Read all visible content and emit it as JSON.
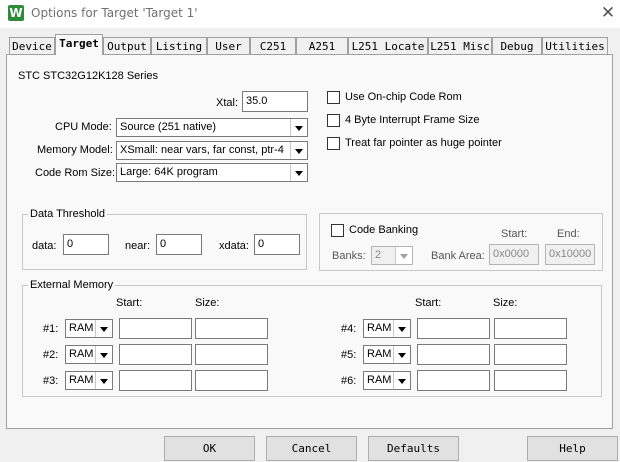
{
  "window": {
    "title": "Options for Target 'Target 1'",
    "app_icon_letter": "W"
  },
  "tabs": [
    "Device",
    "Target",
    "Output",
    "Listing",
    "User",
    "C251",
    "A251",
    "L251 Locate",
    "L251 Misc",
    "Debug",
    "Utilities"
  ],
  "active_tab": "Target",
  "target": {
    "series": "STC STC32G12K128 Series",
    "xtal_label": "Xtal:",
    "xtal_value": "35.0",
    "cpu_mode_label": "CPU Mode:",
    "cpu_mode_value": "Source (251 native)",
    "memory_model_label": "Memory Model:",
    "memory_model_value": "XSmall: near vars, far const, ptr-4",
    "code_rom_label": "Code Rom Size:",
    "code_rom_value": "Large: 64K program",
    "use_onchip_rom": "Use On-chip Code Rom",
    "four_byte_irq": "4 Byte Interrupt Frame Size",
    "far_pointer": "Treat far pointer as huge pointer"
  },
  "data_threshold": {
    "title": "Data Threshold",
    "data_label": "data:",
    "data_value": "0",
    "near_label": "near:",
    "near_value": "0",
    "xdata_label": "xdata:",
    "xdata_value": "0"
  },
  "code_banking": {
    "label": "Code Banking",
    "start_label": "Start:",
    "end_label": "End:",
    "banks_label": "Banks:",
    "banks_value": "2",
    "bank_area_label": "Bank Area:",
    "start_value": "0x0000",
    "end_value": "0x10000"
  },
  "external_memory": {
    "title": "External Memory",
    "start_label": "Start:",
    "size_label": "Size:",
    "rows": [
      {
        "label": "#1:",
        "type": "RAM"
      },
      {
        "label": "#2:",
        "type": "RAM"
      },
      {
        "label": "#3:",
        "type": "RAM"
      },
      {
        "label": "#4:",
        "type": "RAM"
      },
      {
        "label": "#5:",
        "type": "RAM"
      },
      {
        "label": "#6:",
        "type": "RAM"
      }
    ]
  },
  "buttons": {
    "ok": "OK",
    "cancel": "Cancel",
    "defaults": "Defaults",
    "help": "Help"
  }
}
